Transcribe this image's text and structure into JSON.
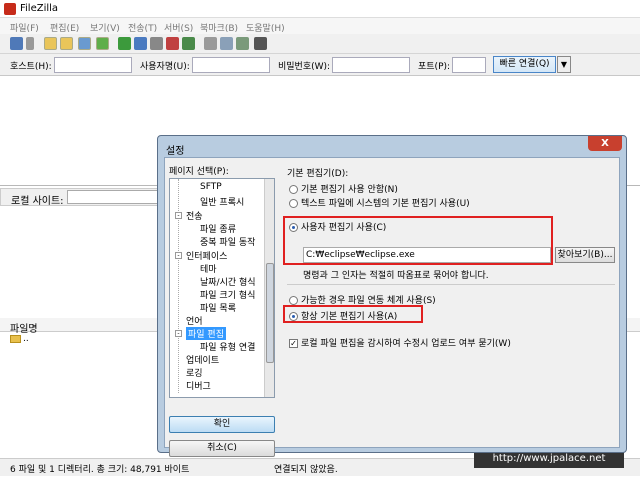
{
  "window": {
    "title": "FileZilla"
  },
  "menu": [
    "파일(F)",
    "편집(E)",
    "보기(V)",
    "전송(T)",
    "서버(S)",
    "북마크(B)",
    "도움말(H)"
  ],
  "quickconnect": {
    "host_label": "호스트(H):",
    "user_label": "사용자명(U):",
    "pass_label": "비밀번호(W):",
    "port_label": "포트(P):",
    "connect_label": "빠른 연결(Q)",
    "dropdown_glyph": "▼"
  },
  "local": {
    "site_label": "로컬 사이트:",
    "filename_header": "파일명",
    "parent_dir": ".."
  },
  "status": {
    "local_summary": "6 파일 및 1 디렉터리. 총 크기: 48,791 바이트",
    "remote_summary": "연결되지 않았음."
  },
  "watermark": "http://www.jpalace.net",
  "dialog": {
    "title": "설정",
    "close_glyph": "X",
    "page_select_label": "페이지 선택(P):",
    "tree": [
      {
        "label": "SFTP"
      },
      {
        "label": "일반 프록시"
      },
      {
        "label": "전송"
      },
      {
        "label": "파일 종류"
      },
      {
        "label": "중복 파일 동작"
      },
      {
        "label": "인터페이스"
      },
      {
        "label": "테마"
      },
      {
        "label": "날짜/시간 형식"
      },
      {
        "label": "파일 크기 형식"
      },
      {
        "label": "파일 목록"
      },
      {
        "label": "언어"
      },
      {
        "label": "파일 편집"
      },
      {
        "label": "파일 유형 연결"
      },
      {
        "label": "업데이트"
      },
      {
        "label": "로깅"
      },
      {
        "label": "디버그"
      }
    ],
    "ok_label": "확인",
    "cancel_label": "취소(C)",
    "editor_header": "기본 편집기(D):",
    "opt_no_editor": "기본 편집기 사용 안함(N)",
    "opt_system_text_editor": "텍스트 파일에 시스템의 기본 편집기 사용(U)",
    "opt_custom_editor": "사용자 편집기 사용(C)",
    "custom_editor_path": "C:₩eclipse₩eclipse.exe",
    "browse_label": "찾아보기(B)...",
    "quote_hint": "명령과 그 인자는 적절히 따옴표로 묶어야 합니다.",
    "opt_use_assoc": "가능한 경우 파일 연동 체계 사용(S)",
    "opt_always_default": "항상 기본 편집기 사용(A)",
    "watch_files_label": "로컬 파일 편집을 감시하여 수정시 업로드 여부 묻기(W)",
    "selected_editor_option": "custom",
    "selected_assoc_option": "always_default",
    "watch_files_checked": true
  },
  "colors": {
    "highlight": "#e02020",
    "selection": "#3399ff"
  }
}
